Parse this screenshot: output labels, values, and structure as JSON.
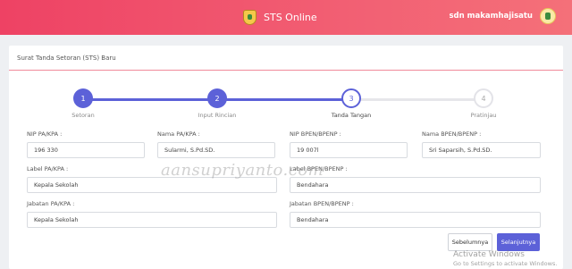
{
  "header": {
    "app_title": "STS Online",
    "user_name": "sdn makamhajisatu",
    "logo_icon": "jateng-crest-icon",
    "brand_gradient": [
      "#ee4264",
      "#f47079"
    ]
  },
  "card": {
    "title": "Surat Tanda Setoran (STS) Baru"
  },
  "stepper": {
    "accent": "#5c61d8",
    "steps": [
      {
        "number": "1",
        "label": "Setoran",
        "state": "done"
      },
      {
        "number": "2",
        "label": "Input Rincian",
        "state": "done"
      },
      {
        "number": "3",
        "label": "Tanda Tangan",
        "state": "active"
      },
      {
        "number": "4",
        "label": "Pratinjau",
        "state": "todo"
      }
    ]
  },
  "form": {
    "nip_pa_kpa": {
      "label": "NIP PA/KPA :",
      "value": "196                 330"
    },
    "nama_pa_kpa": {
      "label": "Nama PA/KPA :",
      "value": "Sularmi, S.Pd.SD."
    },
    "nip_bpen": {
      "label": "NIP BPEN/BPENP :",
      "value": "19                 007l"
    },
    "nama_bpen": {
      "label": "Nama BPEN/BPENP :",
      "value": "Sri Saparsih, S.Pd.SD."
    },
    "label_pa_kpa": {
      "label": "Label PA/KPA :",
      "value": "Kepala Sekolah"
    },
    "label_bpen": {
      "label": "Label BPEN/BPENP :",
      "value": "Bendahara"
    },
    "jabatan_pa_kpa": {
      "label": "Jabatan PA/KPA :",
      "value": "Kepala Sekolah"
    },
    "jabatan_bpen": {
      "label": "Jabatan BPEN/BPENP :",
      "value": "Bendahara"
    }
  },
  "buttons": {
    "prev": "Sebelumnya",
    "next": "Selanjutnya"
  },
  "watermark": "aansupriyanto.com",
  "activate_windows": {
    "title": "Activate Windows",
    "subtitle": "Go to Settings to activate Windows."
  }
}
